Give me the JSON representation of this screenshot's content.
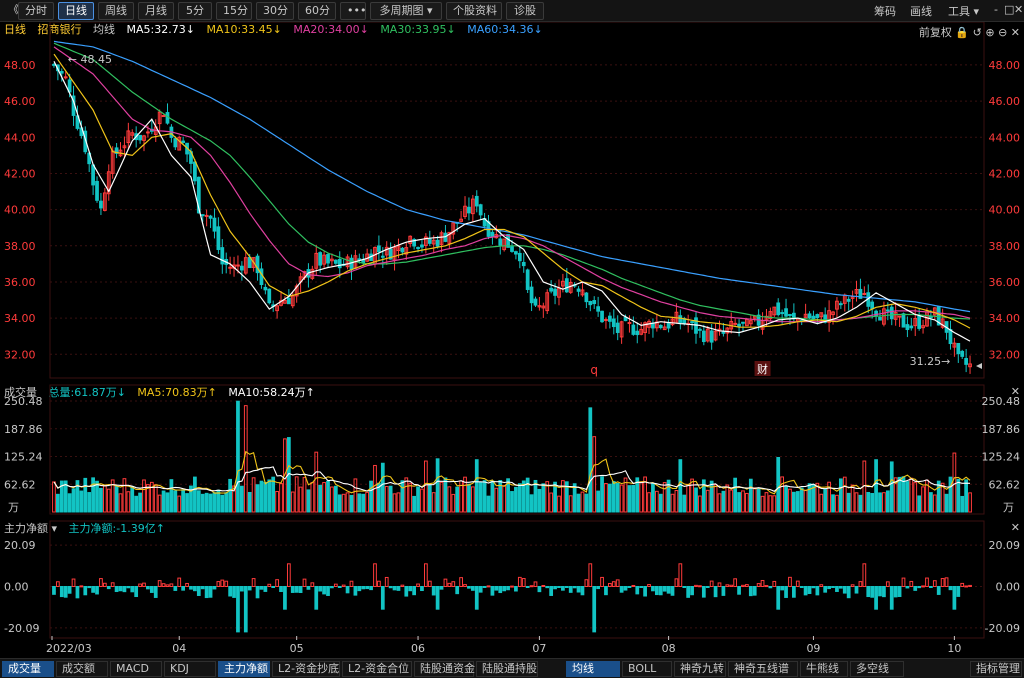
{
  "toolbar": {
    "collapse": "《",
    "buttons": [
      "分时",
      "日线",
      "周线",
      "月线",
      "5分",
      "15分",
      "30分",
      "60分",
      "•••",
      "多周期图 ▾",
      "个股资料",
      "诊股"
    ],
    "active_index": 1,
    "right": [
      "筹码",
      "画线",
      "工具 ▾"
    ]
  },
  "price_info": {
    "period": "日线",
    "name": "招商银行",
    "avg": "均线",
    "ma5": "MA5:32.73↓",
    "ma10": "MA10:33.45↓",
    "ma20": "MA20:34.00↓",
    "ma30": "MA30:33.95↓",
    "ma60": "MA60:34.36↓",
    "fq": "前复权"
  },
  "vol_info": {
    "label": "成交量",
    "total": "总量:61.87万↓",
    "ma5": "MA5:70.83万↑",
    "ma10": "MA10:58.24万↑"
  },
  "flow_info": {
    "label": "主力净额 ▾",
    "value": "主力净额:-1.39亿↑"
  },
  "bottom_tabs": [
    "成交量",
    "成交额",
    "MACD",
    "KDJ",
    "主力净额",
    "L2-资金抄底",
    "L2-资金合位",
    "陆股通资金",
    "陆股通持股",
    "均线",
    "BOLL",
    "神奇九转",
    "神奇五线谱",
    "牛熊线",
    "多空线",
    "指标管理"
  ],
  "bottom_active": [
    0,
    4,
    9
  ],
  "colors": {
    "up": "#ff3b3b",
    "down": "#12c4c4",
    "ma5": "#ffffff",
    "ma10": "#f0c419",
    "ma20": "#e040a0",
    "ma30": "#30c060",
    "ma60": "#3aa0ff",
    "grid": "#3a1010"
  },
  "chart_data": [
    {
      "type": "candlestick",
      "series_name": "招商银行",
      "x_labels": [
        "2022/03",
        "04",
        "05",
        "06",
        "07",
        "08",
        "09",
        "10"
      ],
      "y_ticks": [
        32.0,
        34.0,
        36.0,
        38.0,
        40.0,
        42.0,
        44.0,
        46.0,
        48.0
      ],
      "ylim": [
        30.8,
        49.6
      ],
      "annotations": {
        "high": "48.45",
        "low": "31.25→",
        "markers": [
          "q",
          "财"
        ]
      },
      "ma_anchors": {
        "ma5": [
          [
            0,
            48.2
          ],
          [
            5,
            46.0
          ],
          [
            10,
            42.5
          ],
          [
            14,
            41.0
          ],
          [
            20,
            43.8
          ],
          [
            25,
            45.0
          ],
          [
            30,
            43.0
          ],
          [
            35,
            41.8
          ],
          [
            40,
            37.5
          ],
          [
            45,
            37.0
          ],
          [
            50,
            36.0
          ],
          [
            55,
            34.5
          ],
          [
            60,
            35.2
          ],
          [
            65,
            36.5
          ],
          [
            70,
            36.8
          ],
          [
            75,
            37.0
          ],
          [
            80,
            37.3
          ],
          [
            85,
            37.8
          ],
          [
            90,
            38.2
          ],
          [
            95,
            38.4
          ],
          [
            100,
            38.5
          ],
          [
            105,
            39.2
          ],
          [
            110,
            39.5
          ],
          [
            115,
            38.5
          ],
          [
            120,
            37.8
          ],
          [
            125,
            36.0
          ],
          [
            130,
            35.6
          ],
          [
            135,
            36.0
          ],
          [
            140,
            35.5
          ],
          [
            145,
            34.2
          ],
          [
            150,
            33.6
          ],
          [
            155,
            33.8
          ],
          [
            160,
            33.7
          ],
          [
            165,
            33.6
          ],
          [
            170,
            33.3
          ],
          [
            175,
            33.2
          ],
          [
            180,
            33.5
          ],
          [
            185,
            33.9
          ],
          [
            190,
            34.0
          ],
          [
            195,
            33.7
          ],
          [
            200,
            34.0
          ],
          [
            205,
            34.6
          ],
          [
            210,
            35.4
          ],
          [
            215,
            34.8
          ],
          [
            220,
            34.2
          ],
          [
            225,
            33.9
          ],
          [
            230,
            33.2
          ],
          [
            234,
            32.73
          ]
        ],
        "ma10": [
          [
            0,
            48.6
          ],
          [
            10,
            45.5
          ],
          [
            15,
            43.2
          ],
          [
            20,
            43.0
          ],
          [
            25,
            44.0
          ],
          [
            30,
            44.2
          ],
          [
            35,
            43.2
          ],
          [
            40,
            40.8
          ],
          [
            45,
            38.8
          ],
          [
            50,
            37.4
          ],
          [
            55,
            35.8
          ],
          [
            60,
            35.2
          ],
          [
            65,
            35.5
          ],
          [
            70,
            36.0
          ],
          [
            75,
            36.6
          ],
          [
            80,
            37.0
          ],
          [
            85,
            37.3
          ],
          [
            90,
            37.6
          ],
          [
            95,
            37.8
          ],
          [
            100,
            38.0
          ],
          [
            105,
            38.4
          ],
          [
            110,
            38.9
          ],
          [
            115,
            38.9
          ],
          [
            120,
            38.5
          ],
          [
            125,
            37.6
          ],
          [
            130,
            36.7
          ],
          [
            135,
            36.0
          ],
          [
            140,
            35.8
          ],
          [
            145,
            35.2
          ],
          [
            150,
            34.6
          ],
          [
            155,
            34.1
          ],
          [
            160,
            34.0
          ],
          [
            165,
            33.8
          ],
          [
            170,
            33.7
          ],
          [
            175,
            33.5
          ],
          [
            180,
            33.5
          ],
          [
            185,
            33.6
          ],
          [
            190,
            33.8
          ],
          [
            195,
            33.9
          ],
          [
            200,
            33.8
          ],
          [
            205,
            34.1
          ],
          [
            210,
            34.6
          ],
          [
            215,
            34.8
          ],
          [
            220,
            34.6
          ],
          [
            225,
            34.3
          ],
          [
            230,
            33.9
          ],
          [
            234,
            33.45
          ]
        ],
        "ma20": [
          [
            0,
            49.0
          ],
          [
            10,
            47.5
          ],
          [
            20,
            45.0
          ],
          [
            25,
            44.4
          ],
          [
            30,
            44.3
          ],
          [
            35,
            44.0
          ],
          [
            40,
            43.0
          ],
          [
            45,
            41.5
          ],
          [
            50,
            39.8
          ],
          [
            55,
            38.3
          ],
          [
            60,
            37.0
          ],
          [
            65,
            36.4
          ],
          [
            70,
            36.3
          ],
          [
            75,
            36.5
          ],
          [
            80,
            36.9
          ],
          [
            85,
            37.1
          ],
          [
            90,
            37.3
          ],
          [
            95,
            37.5
          ],
          [
            100,
            37.8
          ],
          [
            105,
            38.0
          ],
          [
            110,
            38.4
          ],
          [
            115,
            38.6
          ],
          [
            120,
            38.4
          ],
          [
            125,
            38.0
          ],
          [
            130,
            37.4
          ],
          [
            135,
            36.8
          ],
          [
            140,
            36.2
          ],
          [
            145,
            35.7
          ],
          [
            150,
            35.3
          ],
          [
            155,
            34.9
          ],
          [
            160,
            34.6
          ],
          [
            165,
            34.3
          ],
          [
            170,
            34.1
          ],
          [
            175,
            34.0
          ],
          [
            180,
            33.9
          ],
          [
            185,
            33.8
          ],
          [
            190,
            33.8
          ],
          [
            195,
            33.8
          ],
          [
            200,
            33.9
          ],
          [
            205,
            34.0
          ],
          [
            210,
            34.2
          ],
          [
            215,
            34.4
          ],
          [
            220,
            34.4
          ],
          [
            225,
            34.3
          ],
          [
            230,
            34.2
          ],
          [
            234,
            34.0
          ]
        ],
        "ma30": [
          [
            0,
            49.2
          ],
          [
            10,
            48.3
          ],
          [
            20,
            46.5
          ],
          [
            30,
            45.0
          ],
          [
            35,
            44.4
          ],
          [
            40,
            43.8
          ],
          [
            45,
            43.0
          ],
          [
            50,
            41.8
          ],
          [
            55,
            40.5
          ],
          [
            60,
            39.2
          ],
          [
            65,
            38.2
          ],
          [
            70,
            37.6
          ],
          [
            75,
            37.2
          ],
          [
            80,
            37.0
          ],
          [
            85,
            37.0
          ],
          [
            90,
            37.1
          ],
          [
            95,
            37.3
          ],
          [
            100,
            37.5
          ],
          [
            105,
            37.7
          ],
          [
            110,
            37.9
          ],
          [
            115,
            38.0
          ],
          [
            120,
            38.0
          ],
          [
            125,
            37.8
          ],
          [
            130,
            37.5
          ],
          [
            135,
            37.1
          ],
          [
            140,
            36.7
          ],
          [
            145,
            36.2
          ],
          [
            150,
            35.8
          ],
          [
            155,
            35.4
          ],
          [
            160,
            35.0
          ],
          [
            165,
            34.7
          ],
          [
            170,
            34.5
          ],
          [
            175,
            34.3
          ],
          [
            180,
            34.1
          ],
          [
            185,
            34.0
          ],
          [
            190,
            34.0
          ],
          [
            195,
            33.9
          ],
          [
            200,
            33.9
          ],
          [
            205,
            34.0
          ],
          [
            210,
            34.1
          ],
          [
            215,
            34.2
          ],
          [
            220,
            34.2
          ],
          [
            225,
            34.1
          ],
          [
            230,
            34.0
          ],
          [
            234,
            33.95
          ]
        ],
        "ma60": [
          [
            0,
            49.3
          ],
          [
            10,
            49.0
          ],
          [
            20,
            48.2
          ],
          [
            30,
            47.2
          ],
          [
            40,
            46.2
          ],
          [
            50,
            45.0
          ],
          [
            60,
            43.6
          ],
          [
            70,
            42.2
          ],
          [
            80,
            41.0
          ],
          [
            90,
            40.0
          ],
          [
            100,
            39.4
          ],
          [
            110,
            39.0
          ],
          [
            120,
            38.6
          ],
          [
            130,
            38.0
          ],
          [
            140,
            37.4
          ],
          [
            150,
            37.0
          ],
          [
            160,
            36.6
          ],
          [
            170,
            36.2
          ],
          [
            180,
            35.9
          ],
          [
            190,
            35.6
          ],
          [
            200,
            35.3
          ],
          [
            210,
            35.1
          ],
          [
            220,
            34.9
          ],
          [
            230,
            34.5
          ],
          [
            234,
            34.36
          ]
        ]
      },
      "close_anchors": [
        [
          0,
          48.0
        ],
        [
          3,
          47.2
        ],
        [
          5,
          45.5
        ],
        [
          8,
          43.5
        ],
        [
          10,
          41.5
        ],
        [
          12,
          40.0
        ],
        [
          14,
          42.5
        ],
        [
          17,
          43.5
        ],
        [
          20,
          44.2
        ],
        [
          23,
          44.0
        ],
        [
          26,
          45.0
        ],
        [
          28,
          45.5
        ],
        [
          30,
          44.0
        ],
        [
          33,
          43.6
        ],
        [
          35,
          42.6
        ],
        [
          37,
          40.2
        ],
        [
          40,
          39.5
        ],
        [
          43,
          37.0
        ],
        [
          46,
          36.8
        ],
        [
          49,
          37.2
        ],
        [
          52,
          36.8
        ],
        [
          55,
          34.5
        ],
        [
          58,
          35.0
        ],
        [
          61,
          35.2
        ],
        [
          64,
          36.3
        ],
        [
          67,
          37.2
        ],
        [
          70,
          37.0
        ],
        [
          73,
          36.9
        ],
        [
          76,
          37.1
        ],
        [
          79,
          37.3
        ],
        [
          82,
          37.8
        ],
        [
          85,
          37.6
        ],
        [
          88,
          37.9
        ],
        [
          91,
          38.5
        ],
        [
          94,
          38.1
        ],
        [
          97,
          38.2
        ],
        [
          100,
          38.6
        ],
        [
          103,
          39.3
        ],
        [
          106,
          40.0
        ],
        [
          108,
          40.5
        ],
        [
          110,
          39.2
        ],
        [
          113,
          38.5
        ],
        [
          116,
          38.1
        ],
        [
          119,
          37.6
        ],
        [
          121,
          35.4
        ],
        [
          123,
          34.3
        ],
        [
          126,
          35.0
        ],
        [
          129,
          35.6
        ],
        [
          132,
          36.0
        ],
        [
          135,
          35.7
        ],
        [
          138,
          34.5
        ],
        [
          141,
          33.8
        ],
        [
          144,
          33.3
        ],
        [
          147,
          33.5
        ],
        [
          150,
          33.4
        ],
        [
          153,
          33.8
        ],
        [
          156,
          33.6
        ],
        [
          159,
          33.9
        ],
        [
          162,
          33.7
        ],
        [
          165,
          33.2
        ],
        [
          168,
          33.0
        ],
        [
          171,
          33.1
        ],
        [
          174,
          33.6
        ],
        [
          177,
          33.5
        ],
        [
          180,
          33.8
        ],
        [
          183,
          34.6
        ],
        [
          186,
          34.3
        ],
        [
          189,
          33.8
        ],
        [
          192,
          34.2
        ],
        [
          195,
          33.9
        ],
        [
          198,
          34.2
        ],
        [
          201,
          34.8
        ],
        [
          204,
          35.2
        ],
        [
          207,
          35.4
        ],
        [
          210,
          34.5
        ],
        [
          213,
          34.0
        ],
        [
          216,
          33.8
        ],
        [
          219,
          33.6
        ],
        [
          222,
          33.9
        ],
        [
          225,
          34.2
        ],
        [
          228,
          33.4
        ],
        [
          231,
          31.6
        ],
        [
          234,
          31.35
        ]
      ],
      "count": 235
    },
    {
      "type": "bar",
      "series_name": "成交量",
      "unit": "万",
      "y_ticks": [
        62.62,
        125.24,
        187.86,
        250.48
      ],
      "ylim": [
        0,
        250.48
      ],
      "spikes": [
        [
          47,
          250
        ],
        [
          49,
          240
        ],
        [
          59,
          165
        ],
        [
          60,
          168
        ],
        [
          67,
          135
        ],
        [
          82,
          105
        ],
        [
          84,
          110
        ],
        [
          95,
          115
        ],
        [
          98,
          120
        ],
        [
          108,
          118
        ],
        [
          137,
          235
        ],
        [
          138,
          170
        ],
        [
          160,
          118
        ],
        [
          185,
          123
        ],
        [
          207,
          115
        ],
        [
          210,
          118
        ],
        [
          214,
          113
        ],
        [
          230,
          133
        ]
      ]
    },
    {
      "type": "bar",
      "series_name": "主力净额",
      "y_ticks": [
        -20.09,
        0.0,
        20.09
      ],
      "ylim": [
        -24,
        24
      ],
      "values_hint": "mixed positive and negative daily net flow"
    }
  ]
}
